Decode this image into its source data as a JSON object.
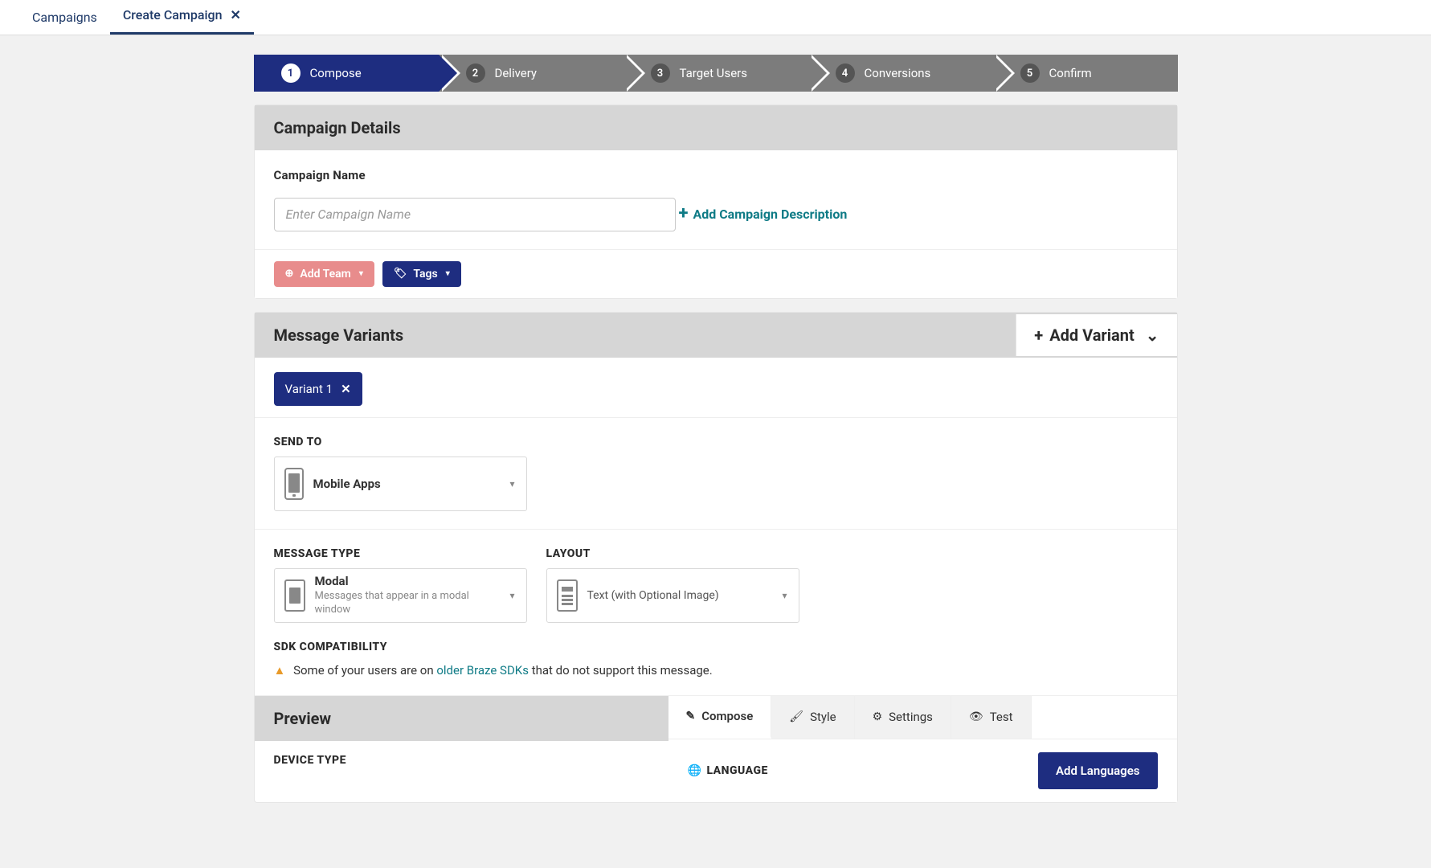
{
  "tabs": {
    "campaigns": "Campaigns",
    "create": "Create Campaign"
  },
  "stepper": [
    {
      "num": "1",
      "label": "Compose",
      "active": true
    },
    {
      "num": "2",
      "label": "Delivery",
      "active": false
    },
    {
      "num": "3",
      "label": "Target Users",
      "active": false
    },
    {
      "num": "4",
      "label": "Conversions",
      "active": false
    },
    {
      "num": "5",
      "label": "Confirm",
      "active": false
    }
  ],
  "details": {
    "header": "Campaign Details",
    "name_label": "Campaign Name",
    "name_placeholder": "Enter Campaign Name",
    "add_desc": "Add Campaign Description",
    "add_team": "Add Team",
    "tags": "Tags"
  },
  "variants": {
    "header": "Message Variants",
    "add_variant": "Add Variant",
    "tab": "Variant 1",
    "send_to": "SEND TO",
    "send_to_value": "Mobile Apps",
    "msg_type": "MESSAGE TYPE",
    "msg_type_value": "Modal",
    "msg_type_desc": "Messages that appear in a modal window",
    "layout": "LAYOUT",
    "layout_value": "Text (with Optional Image)",
    "sdk_compat": "SDK COMPATIBILITY",
    "sdk_pre": "Some of your users are on ",
    "sdk_link": "older Braze SDKs",
    "sdk_post": " that do not support this message."
  },
  "preview": {
    "header": "Preview",
    "device_type": "DEVICE TYPE",
    "tabs": {
      "compose": "Compose",
      "style": "Style",
      "settings": "Settings",
      "test": "Test"
    },
    "language": "LANGUAGE",
    "add_languages": "Add Languages"
  }
}
